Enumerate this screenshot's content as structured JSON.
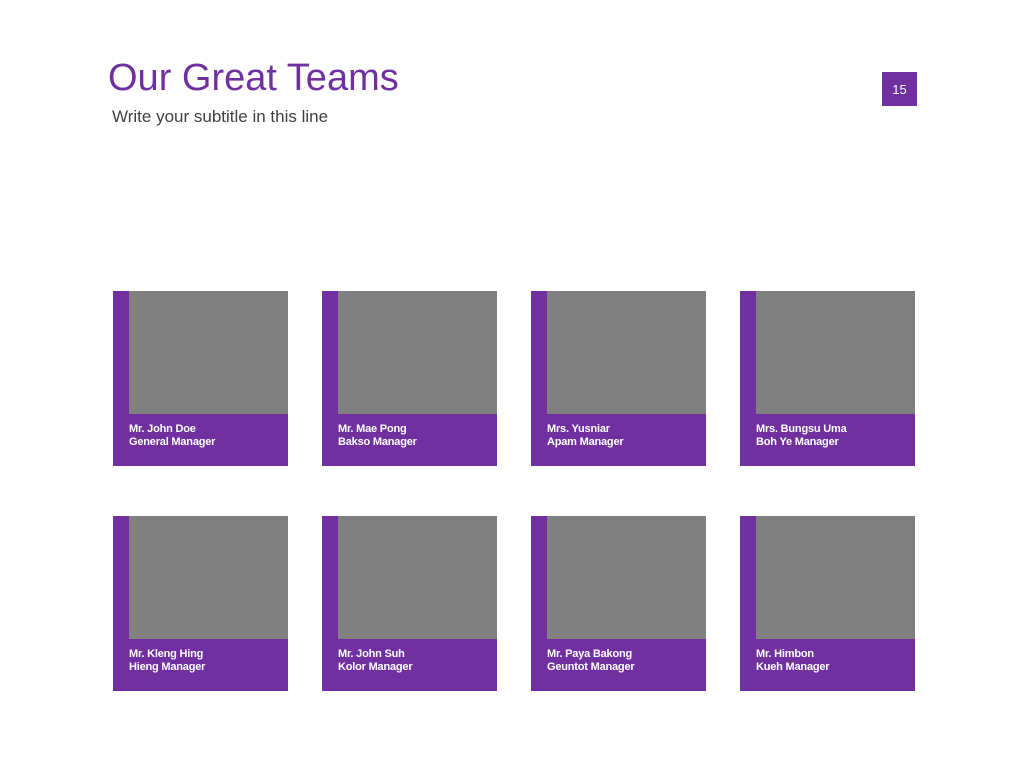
{
  "slide": {
    "title": "Our Great Teams",
    "subtitle": "Write your subtitle in this line",
    "page_number": "15"
  },
  "colors": {
    "accent": "#7030a0",
    "photo_placeholder": "#808080",
    "subtitle_text": "#404040",
    "caption_text": "#ffffff"
  },
  "team": [
    {
      "name": "Mr. John Doe",
      "role": "General Manager"
    },
    {
      "name": "Mr. Mae Pong",
      "role": "Bakso Manager"
    },
    {
      "name": "Mrs. Yusniar",
      "role": "Apam Manager"
    },
    {
      "name": "Mrs. Bungsu Uma",
      "role": "Boh Ye Manager"
    },
    {
      "name": "Mr. Kleng Hing",
      "role": "Hieng Manager"
    },
    {
      "name": "Mr. John Suh",
      "role": "Kolor Manager"
    },
    {
      "name": "Mr. Paya Bakong",
      "role": "Geuntot Manager"
    },
    {
      "name": "Mr. Himbon",
      "role": "Kueh Manager"
    }
  ]
}
